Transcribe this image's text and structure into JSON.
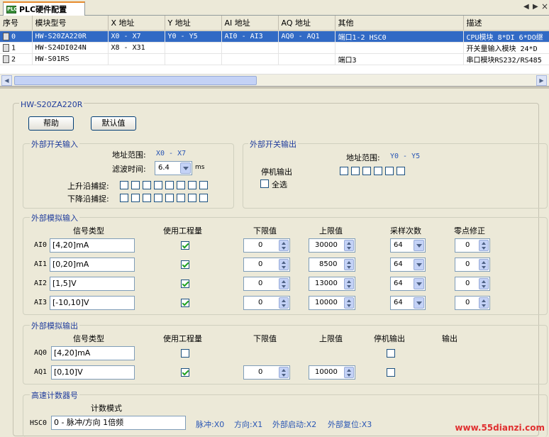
{
  "tab": {
    "label": "PLC硬件配置",
    "icon": "plc-icon",
    "prev": "◀",
    "next": "▶",
    "close": "×"
  },
  "table": {
    "headers": [
      "序号",
      "模块型号",
      "X 地址",
      "Y 地址",
      "AI 地址",
      "AQ 地址",
      "其他",
      "描述"
    ],
    "rows": [
      [
        "0",
        "HW-S20ZA220R",
        "X0 - X7",
        "Y0 - Y5",
        "AI0 - AI3",
        "AQ0 - AQ1",
        "端口1-2 HSC0",
        "CPU模块 8*DI 6*DO继"
      ],
      [
        "1",
        "HW-S24DI024N",
        "X8 - X31",
        "",
        "",
        "",
        "",
        "开关量输入模块 24*D"
      ],
      [
        "2",
        "HW-S01RS",
        "",
        "",
        "",
        "",
        "端口3",
        "串口模块RS232/RS485"
      ]
    ]
  },
  "scroll": {
    "left": "◀",
    "right": "▶"
  },
  "device": {
    "name": "HW-S20ZA220R",
    "help_label": "帮助",
    "default_label": "默认值"
  },
  "din": {
    "title": "外部开关输入",
    "range_label": "地址范围:",
    "range_value": "X0 - X7",
    "filter_label": "滤波时间:",
    "filter_value": "6.4",
    "filter_unit": "ms",
    "rising_label": "上升沿捕捉:",
    "falling_label": "下降沿捕捉:"
  },
  "dout": {
    "title": "外部开关输出",
    "range_label": "地址范围:",
    "range_value": "Y0 - Y5",
    "stop_label": "停机输出",
    "all_label": "全选"
  },
  "ain": {
    "title": "外部模拟输入",
    "headers": [
      "信号类型",
      "使用工程量",
      "下限值",
      "上限值",
      "采样次数",
      "零点修正"
    ],
    "rows": [
      {
        "name": "AI0",
        "type": "[4,20]mA",
        "eng": true,
        "low": "0",
        "high": "30000",
        "samples": "64",
        "zero": "0"
      },
      {
        "name": "AI1",
        "type": "[0,20]mA",
        "eng": true,
        "low": "0",
        "high": "8500",
        "samples": "64",
        "zero": "0"
      },
      {
        "name": "AI2",
        "type": "[1,5]V",
        "eng": true,
        "low": "0",
        "high": "13000",
        "samples": "64",
        "zero": "0"
      },
      {
        "name": "AI3",
        "type": "[-10,10]V",
        "eng": true,
        "low": "0",
        "high": "10000",
        "samples": "64",
        "zero": "0"
      }
    ]
  },
  "aout": {
    "title": "外部模拟输出",
    "headers": [
      "信号类型",
      "使用工程量",
      "下限值",
      "上限值",
      "停机输出",
      "输出"
    ],
    "rows": [
      {
        "name": "AQ0",
        "type": "[4,20]mA",
        "eng": false,
        "stop": false
      },
      {
        "name": "AQ1",
        "type": "[0,10]V",
        "eng": true,
        "low": "0",
        "high": "10000",
        "stop": false
      }
    ]
  },
  "hsc": {
    "title": "高速计数器号",
    "mode_header": "计数模式",
    "name": "HSC0",
    "mode_value": "0 - 脉冲/方向 1倍频",
    "pulse": "脉冲:X0",
    "dir": "方向:X1",
    "ext_start": "外部启动:X2",
    "ext_reset": "外部复位:X3"
  },
  "watermark": "www.55dianzi.com",
  "colors": {
    "selection": "#316ac5",
    "group_title": "#1f3c9c",
    "check": "#21a121",
    "accent_tab": "#e68b2c"
  }
}
